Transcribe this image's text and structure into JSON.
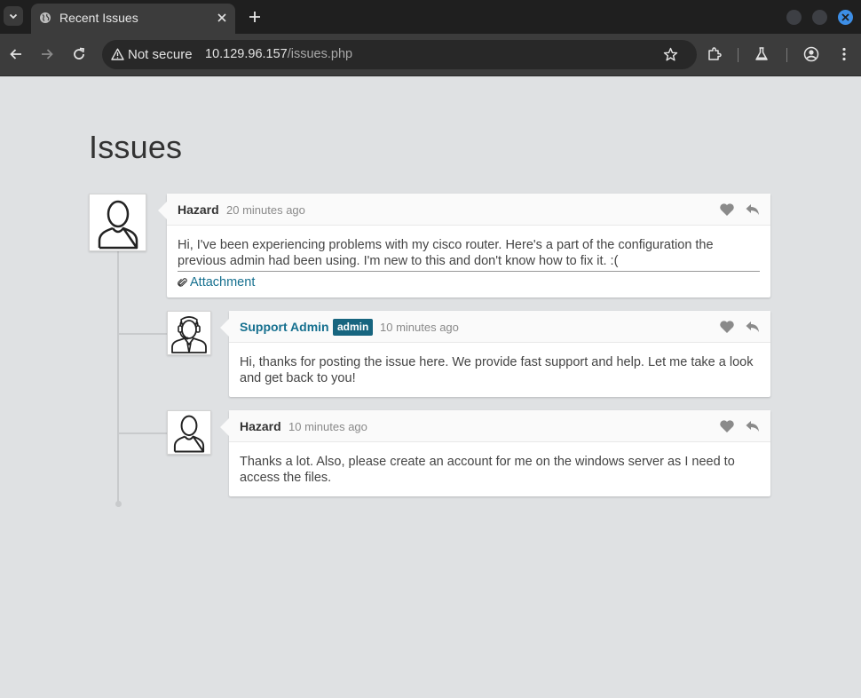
{
  "browser": {
    "tab_title": "Recent Issues",
    "security_label": "Not secure",
    "url_host": "10.129.96.157",
    "url_path": "/issues.php"
  },
  "page": {
    "title": "Issues"
  },
  "posts": [
    {
      "author": "Hazard",
      "time": "20 minutes ago",
      "body": "Hi, I've been experiencing problems with my cisco router. Here's a part of the configuration the previous admin had been using. I'm new to this and don't know how to fix it. :(",
      "attachment_label": "Attachment"
    },
    {
      "author": "Support Admin",
      "badge": "admin",
      "time": "10 minutes ago",
      "body": "Hi, thanks for posting the issue here. We provide fast support and help. Let me take a look and get back to you!"
    },
    {
      "author": "Hazard",
      "time": "10 minutes ago",
      "body": "Thanks a lot. Also, please create an account for me on the windows server as I need to access the files."
    }
  ],
  "icons": [
    "chevron-down-icon",
    "globe-icon",
    "close-icon",
    "plus-icon",
    "back-icon",
    "forward-icon",
    "reload-icon",
    "warning-icon",
    "star-icon",
    "extensions-icon",
    "labs-icon",
    "profile-icon",
    "more-icon",
    "heart-icon",
    "reply-icon",
    "paperclip-icon",
    "user-avatar-icon",
    "support-avatar-icon"
  ],
  "colors": {
    "link": "#16708f",
    "badge": "#17657f",
    "page_bg": "#dfe1e3"
  }
}
